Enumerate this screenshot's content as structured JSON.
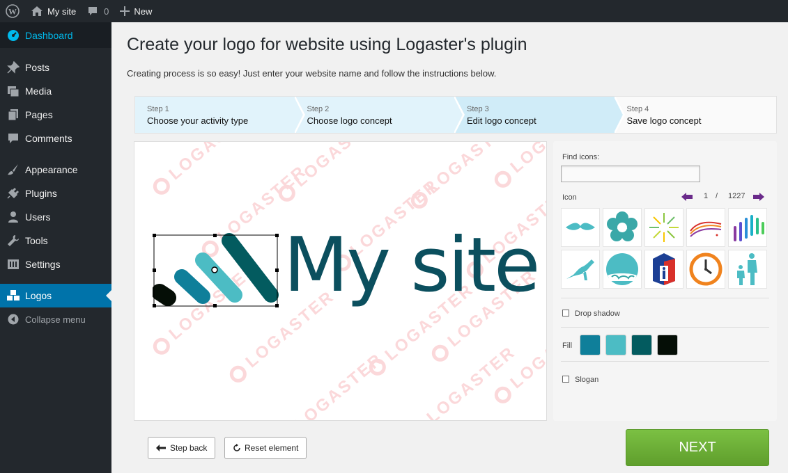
{
  "adminbar": {
    "site_name": "My site",
    "comments_count": "0",
    "new_label": "New"
  },
  "sidebar": {
    "items": [
      {
        "label": "Dashboard",
        "icon": "dashboard-icon"
      },
      {
        "label": "Posts",
        "icon": "pin-icon"
      },
      {
        "label": "Media",
        "icon": "media-icon"
      },
      {
        "label": "Pages",
        "icon": "pages-icon"
      },
      {
        "label": "Comments",
        "icon": "comment-icon"
      },
      {
        "label": "Appearance",
        "icon": "brush-icon"
      },
      {
        "label": "Plugins",
        "icon": "plug-icon"
      },
      {
        "label": "Users",
        "icon": "user-icon"
      },
      {
        "label": "Tools",
        "icon": "wrench-icon"
      },
      {
        "label": "Settings",
        "icon": "settings-icon"
      },
      {
        "label": "Logos",
        "icon": "cubes-icon"
      }
    ],
    "collapse_label": "Collapse menu"
  },
  "page": {
    "title": "Create your logo for website using Logaster's plugin",
    "subtitle": "Creating process is so easy! Just enter your website name and follow the instructions below."
  },
  "steps": [
    {
      "num": "Step 1",
      "label": "Choose your activity type"
    },
    {
      "num": "Step 2",
      "label": "Choose logo concept"
    },
    {
      "num": "Step 3",
      "label": "Edit logo concept"
    },
    {
      "num": "Step 4",
      "label": "Save logo concept"
    }
  ],
  "canvas": {
    "logo_text": "My site",
    "watermark": "LOGASTER"
  },
  "panel": {
    "find_label": "Find icons:",
    "find_value": "",
    "icon_label": "Icon",
    "page_current": "1",
    "page_sep": "/",
    "page_total": "1227",
    "drop_shadow_label": "Drop shadow",
    "fill_label": "Fill",
    "slogan_label": "Slogan",
    "fill_colors": [
      "#0f7f9a",
      "#4cbcc4",
      "#035b5f",
      "#050e06"
    ]
  },
  "buttons": {
    "step_back": "Step back",
    "reset": "Reset element",
    "next": "NEXT"
  },
  "colors": {
    "brand_dark": "#0b4f5e",
    "brand_teal": "#4cbcc4",
    "wp_blue": "#0073aa",
    "next_green": "#6aac35"
  }
}
